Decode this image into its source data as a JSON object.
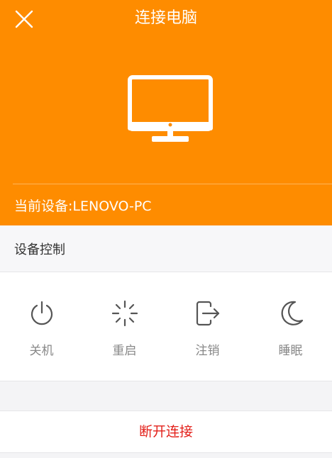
{
  "header": {
    "title": "连接电脑",
    "close_icon": "close-icon",
    "device_icon": "monitor-icon",
    "current_device": "当前设备:LENOVO-PC",
    "background_color": "#fe8c00"
  },
  "section": {
    "title": "设备控制"
  },
  "controls": [
    {
      "label": "关机",
      "icon": "power-icon"
    },
    {
      "label": "重启",
      "icon": "restart-icon"
    },
    {
      "label": "注销",
      "icon": "logout-icon"
    },
    {
      "label": "睡眠",
      "icon": "sleep-icon"
    }
  ],
  "disconnect": {
    "label": "断开连接",
    "color": "#e3211b"
  }
}
